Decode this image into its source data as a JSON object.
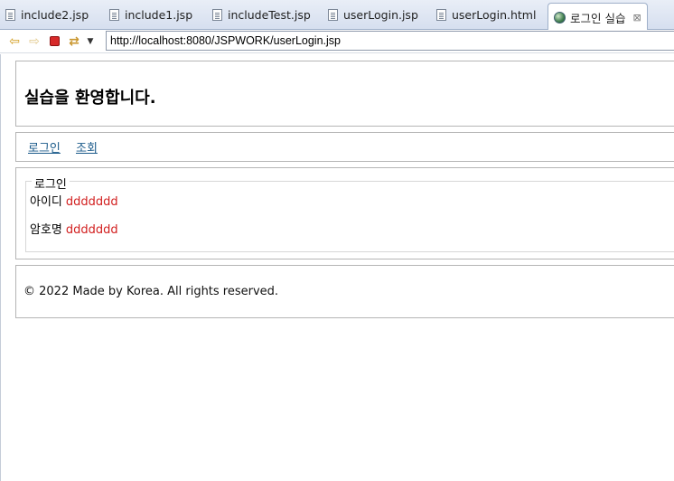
{
  "tabs": [
    {
      "label": "include2.jsp",
      "icon": "file-icon"
    },
    {
      "label": "include1.jsp",
      "icon": "file-icon"
    },
    {
      "label": "includeTest.jsp",
      "icon": "file-icon"
    },
    {
      "label": "userLogin.jsp",
      "icon": "file-icon"
    },
    {
      "label": "userLogin.html",
      "icon": "file-icon"
    },
    {
      "label": "로그인 실습",
      "icon": "globe-icon",
      "active": true,
      "close_glyph": "⊠"
    }
  ],
  "navbar": {
    "back_glyph": "⇦",
    "forward_glyph": "⇨",
    "refresh_glyph": "⇄",
    "dropdown_glyph": "▼",
    "url": "http://localhost:8080/JSPWORK/userLogin.jsp"
  },
  "page": {
    "title": "실습을 환영합니다.",
    "nav_links": [
      "로그인",
      "조회"
    ],
    "login": {
      "legend": "로그인",
      "fields": [
        {
          "label": "아이디",
          "value": "ddddddd"
        },
        {
          "label": "암호명",
          "value": "ddddddd"
        }
      ]
    },
    "footer": "© 2022 Made by Korea. All rights reserved."
  },
  "colors": {
    "link": "#1a5a8a",
    "value_text": "#d21f1f",
    "border": "#b5b5b5"
  }
}
